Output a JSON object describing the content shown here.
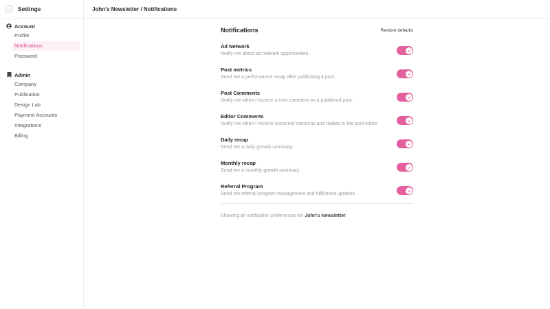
{
  "sidebar": {
    "title": "Settings",
    "groups": [
      {
        "label": "Account",
        "icon": "user-circle-icon",
        "items": [
          "Profile",
          "Notifications",
          "Password"
        ]
      },
      {
        "label": "Admin",
        "icon": "bookmark-icon",
        "items": [
          "Company",
          "Publication",
          "Design Lab",
          "Payment Accounts",
          "Integrations",
          "Billing"
        ]
      }
    ],
    "active_item": "Notifications"
  },
  "breadcrumb": "John's Newsletter / Notifications",
  "main": {
    "title": "Notifications",
    "restore_label": "Restore defaults",
    "accent_color": "#e35f9d",
    "rows": [
      {
        "title": "Ad Network",
        "desc": "Notify me about ad network opportunities.",
        "enabled": true
      },
      {
        "title": "Post metrics",
        "desc": "Send me a performance recap after publishing a post.",
        "enabled": true
      },
      {
        "title": "Post Comments",
        "desc": "Notify me when I receive a new comment on a published post.",
        "enabled": true
      },
      {
        "title": "Editor Comments",
        "desc": "Notify me when I receive comment mentions and replies in the post editor.",
        "enabled": true
      },
      {
        "title": "Daily recap",
        "desc": "Send me a daily growth summary.",
        "enabled": true
      },
      {
        "title": "Monthly recap",
        "desc": "Send me a monthly growth summary.",
        "enabled": true
      },
      {
        "title": "Referral Program",
        "desc": "Send me referral program management and fulfillment updates.",
        "enabled": true
      }
    ],
    "footer_prefix": "Showing all notification preferences for ",
    "footer_name": "John's Newsletter",
    "footer_suffix": "."
  }
}
